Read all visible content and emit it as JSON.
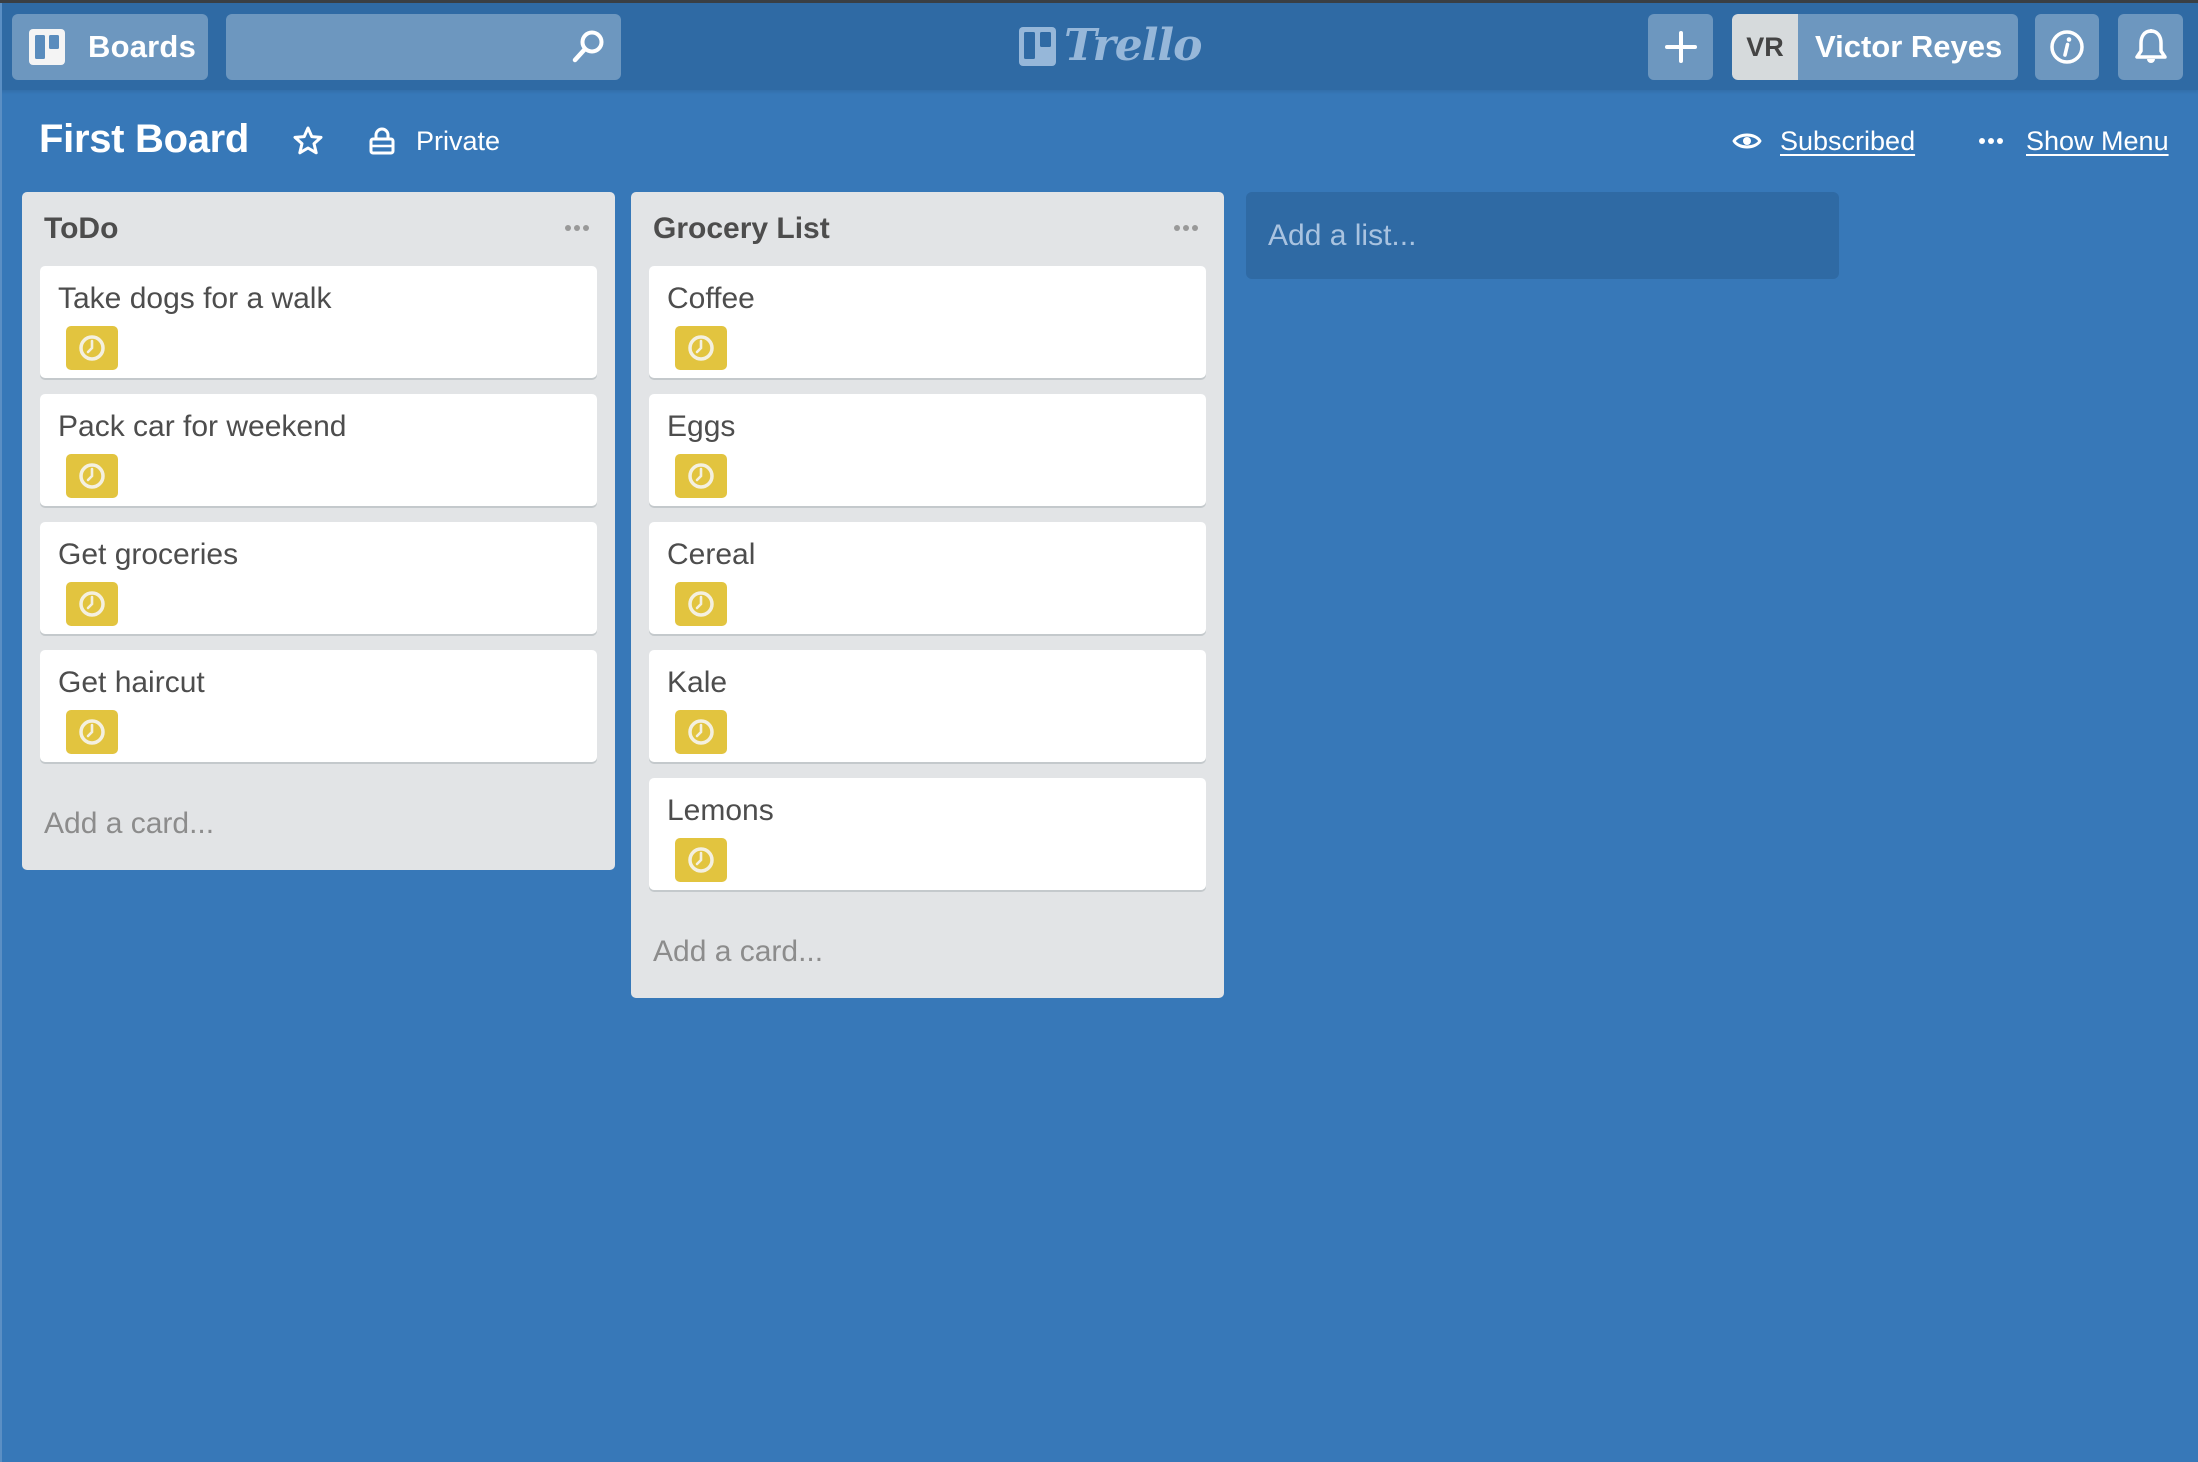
{
  "header": {
    "boards_label": "Boards",
    "search": {
      "value": "",
      "placeholder": ""
    },
    "logo_text": "Trello",
    "user": {
      "initials": "VR",
      "name": "Victor Reyes"
    },
    "icons": {
      "boards": "boards-icon",
      "search": "search-icon",
      "add": "plus-icon",
      "info": "info-icon",
      "notifications": "bell-icon"
    }
  },
  "board": {
    "title": "First Board",
    "visibility": "Private",
    "subscribed_label": "Subscribed",
    "show_menu_label": "Show Menu"
  },
  "lists": [
    {
      "title": "ToDo",
      "cards": [
        {
          "title": "Take dogs for a walk",
          "badge": "due-date-clock"
        },
        {
          "title": "Pack car for weekend",
          "badge": "due-date-clock"
        },
        {
          "title": "Get groceries",
          "badge": "due-date-clock"
        },
        {
          "title": "Get haircut",
          "badge": "due-date-clock"
        }
      ],
      "add_card_label": "Add a card..."
    },
    {
      "title": "Grocery List",
      "cards": [
        {
          "title": "Coffee",
          "badge": "due-date-clock"
        },
        {
          "title": "Eggs",
          "badge": "due-date-clock"
        },
        {
          "title": "Cereal",
          "badge": "due-date-clock"
        },
        {
          "title": "Kale",
          "badge": "due-date-clock"
        },
        {
          "title": "Lemons",
          "badge": "due-date-clock"
        }
      ],
      "add_card_label": "Add a card..."
    }
  ],
  "add_list_label": "Add a list...",
  "colors": {
    "board_background": "#3778b8",
    "header_background": "#2f6aa4",
    "list_background": "#e2e4e6",
    "badge_yellow": "#e2c43f"
  }
}
